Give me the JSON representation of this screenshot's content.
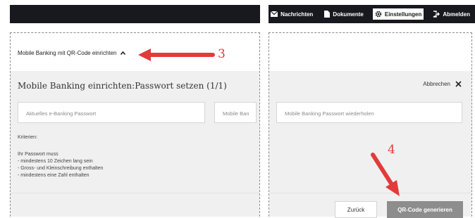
{
  "topnav": {
    "items": [
      {
        "label": "Nachrichten",
        "icon": "envelope-icon",
        "active": false
      },
      {
        "label": "Dokumente",
        "icon": "document-icon",
        "active": false
      },
      {
        "label": "Einstellungen",
        "icon": "gear-icon",
        "active": true
      },
      {
        "label": "Abmelden",
        "icon": "logout-icon",
        "active": false
      }
    ]
  },
  "accordion": {
    "label": "Mobile Banking mit QR-Code einrichten",
    "icon": "chevron-up-icon"
  },
  "setup": {
    "title": "Mobile Banking einrichten:Passwort setzen (1/1)",
    "cancel_label": "Abbrechen",
    "current_password_placeholder": "Aktuelles e-Banking Passwort",
    "new_password_placeholder": "Mobile Banking Passwort",
    "new_password_visible": "Mobile Ban",
    "repeat_password_placeholder": "Mobile Banking Passwort wiederholen"
  },
  "criteria": {
    "heading": "Kriterien:",
    "intro": "Ihr Passwort muss",
    "rules": [
      "- mindestens 10 Zeichen lang sein",
      "- Gross- und Kleinschreibung enthalten",
      "- mindestens eine Zahl enthalten"
    ]
  },
  "buttons": {
    "back_label": "Zurück",
    "generate_label": "QR-Code generieren"
  },
  "annotations": {
    "step3": "3",
    "step4": "4",
    "color": "#e23b3b"
  },
  "colors": {
    "topbar": "#17191e",
    "panel_bg": "#f0f0f0",
    "primary_button": "#8d8d8d"
  }
}
